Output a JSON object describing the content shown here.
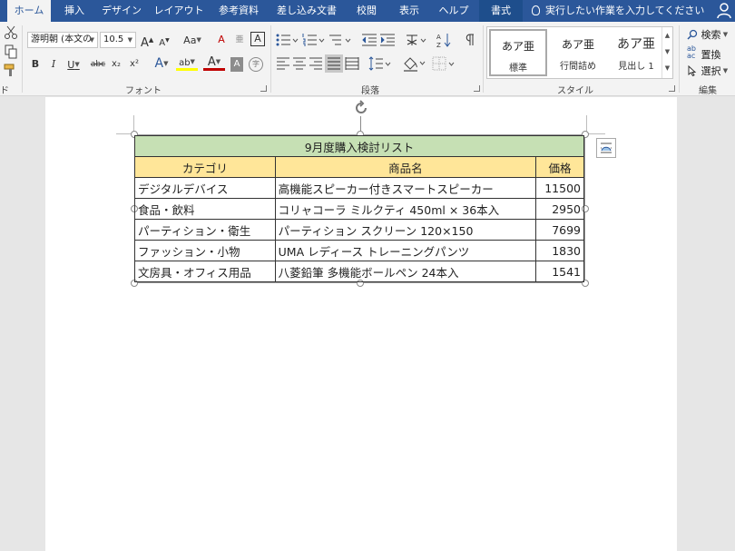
{
  "tabs": [
    {
      "label": "ホーム",
      "active": true
    },
    {
      "label": "挿入"
    },
    {
      "label": "デザイン"
    },
    {
      "label": "レイアウト"
    },
    {
      "label": "参考資料"
    },
    {
      "label": "差し込み文書"
    },
    {
      "label": "校閲"
    },
    {
      "label": "表示"
    },
    {
      "label": "ヘルプ"
    },
    {
      "label": "書式",
      "contextual": true
    }
  ],
  "tell_me": "実行したい作業を入力してください",
  "ribbon": {
    "clipboard": {
      "label": "ド"
    },
    "font": {
      "label": "フォント",
      "name": "游明朝 (本文の",
      "size": "10.5",
      "grow": "A",
      "shrink": "A",
      "case": "Aa",
      "bold": "B",
      "italic": "I",
      "underline": "U",
      "strike": "abc",
      "subscript": "x₂",
      "superscript": "x²",
      "effects": "A",
      "highlight": "ab",
      "color": "A",
      "shade": "A",
      "enclose": "字",
      "clear_format": "A",
      "phonetic": "亜",
      "border_char": "A"
    },
    "paragraph": {
      "label": "段落"
    },
    "styles": {
      "label": "スタイル",
      "items": [
        {
          "sample": "あア亜",
          "name": "標準"
        },
        {
          "sample": "あア亜",
          "name": "行間詰め"
        },
        {
          "sample": "あア亜",
          "name": "見出し 1"
        }
      ]
    },
    "editing": {
      "label": "編集",
      "find": "検索",
      "replace": "置換",
      "select": "選択"
    }
  },
  "table": {
    "title": "9月度購入検討リスト",
    "headers": [
      "カテゴリ",
      "商品名",
      "価格"
    ],
    "rows": [
      [
        "デジタルデバイス",
        "高機能スピーカー付きスマートスピーカー",
        "11500"
      ],
      [
        "食品・飲料",
        "コリャコーラ ミルクティ 450ml × 36本入",
        "2950"
      ],
      [
        "パーティション・衛生",
        "パーティション スクリーン 120×150",
        "7699"
      ],
      [
        "ファッション・小物",
        "UMA レディース トレーニングパンツ",
        "1830"
      ],
      [
        "文房具・オフィス用品",
        "八菱鉛筆 多機能ボールペン 24本入",
        "1541"
      ]
    ]
  },
  "colors": {
    "tab_bar": "#2b579a",
    "title_fill": "#c6e0b4",
    "header_fill": "#ffe699",
    "highlight": "#ffff00",
    "font_color": "#c00000"
  }
}
